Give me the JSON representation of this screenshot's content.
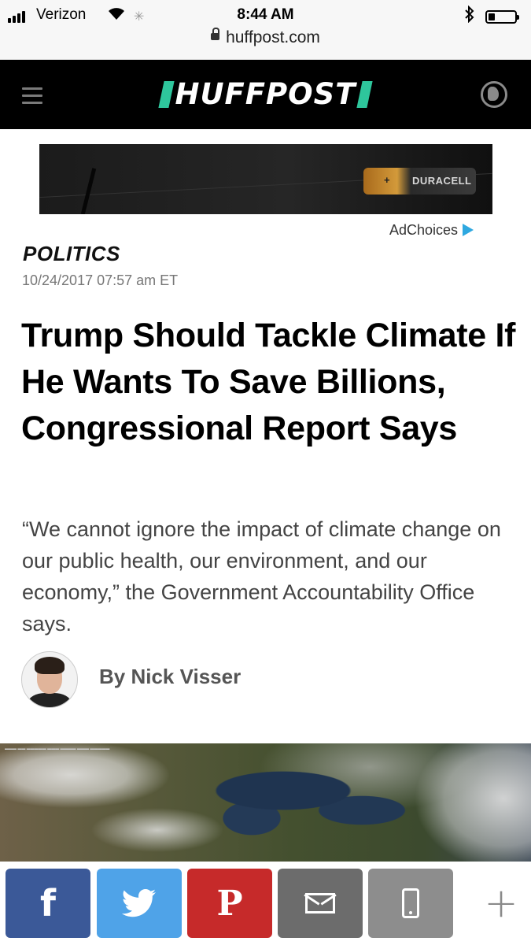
{
  "status_bar": {
    "carrier": "Verizon",
    "time": "8:44 AM",
    "url": "huffpost.com",
    "battery_level": 0.25
  },
  "header": {
    "logo_text": "HUFFPOST",
    "brand_color": "#2ec69c",
    "menu_icon": "hamburger-menu-icon",
    "edition_icon": "globe-icon"
  },
  "ad": {
    "brand": "DURACELL",
    "battery_symbol": "+",
    "adchoices_label": "AdChoices",
    "adchoices_icon": "adchoices-triangle-icon"
  },
  "article": {
    "section": "POLITICS",
    "date": "10/24/2017 07:57 am ET",
    "headline": "Trump Should Tackle Climate If He Wants To Save Billions, Congressional Report Says",
    "dek": "“We cannot ignore the impact of climate change on our public health, our environment, and our economy,” the Government Accountability Office says.",
    "byline": "By Nick Visser"
  },
  "share": {
    "facebook_glyph": "f",
    "pinterest_glyph": "P",
    "more_glyph": "+",
    "colors": {
      "facebook": "#3b5998",
      "twitter": "#4fa3e8",
      "pinterest": "#c62a2a",
      "email": "#6c6c6c",
      "sms": "#8d8d8d"
    }
  }
}
